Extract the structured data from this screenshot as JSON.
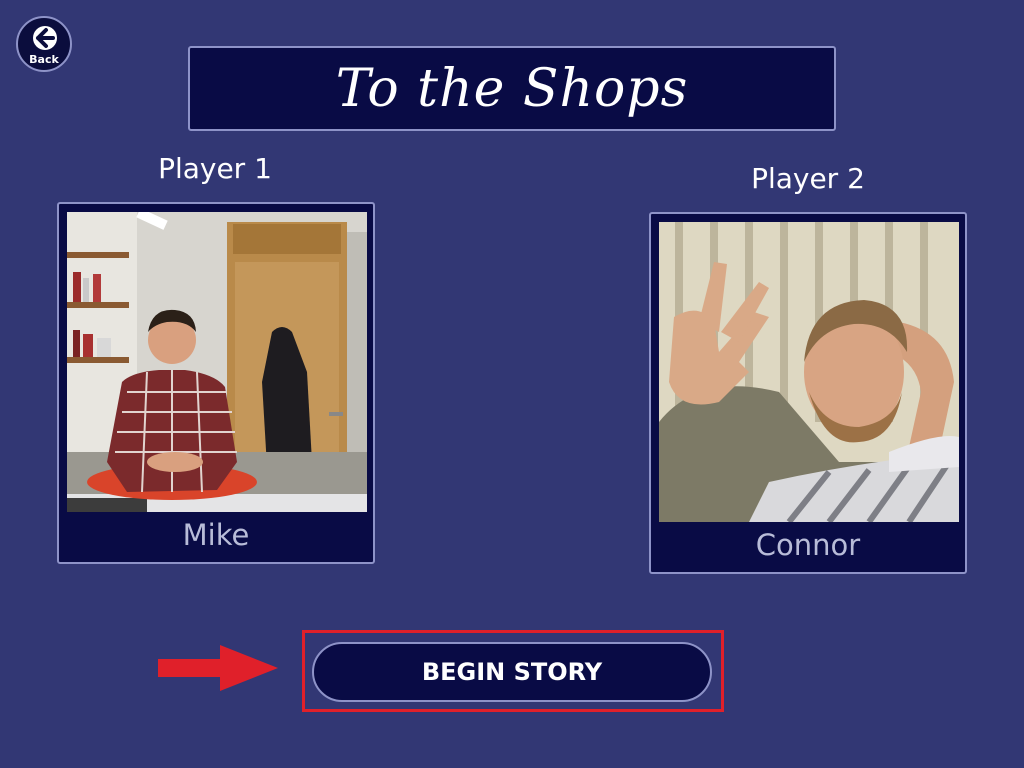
{
  "header": {
    "back_label": "Back",
    "title": "To the Shops"
  },
  "players": [
    {
      "label": "Player 1",
      "name": "Mike"
    },
    {
      "label": "Player 2",
      "name": "Connor"
    }
  ],
  "actions": {
    "begin_label": "BEGIN STORY"
  },
  "colors": {
    "background": "#323774",
    "panel": "#090b45",
    "border": "#8e93c8",
    "highlight": "#e0202a"
  },
  "icons": {
    "back": "arrow-left-icon",
    "pointer": "arrow-right-icon"
  }
}
